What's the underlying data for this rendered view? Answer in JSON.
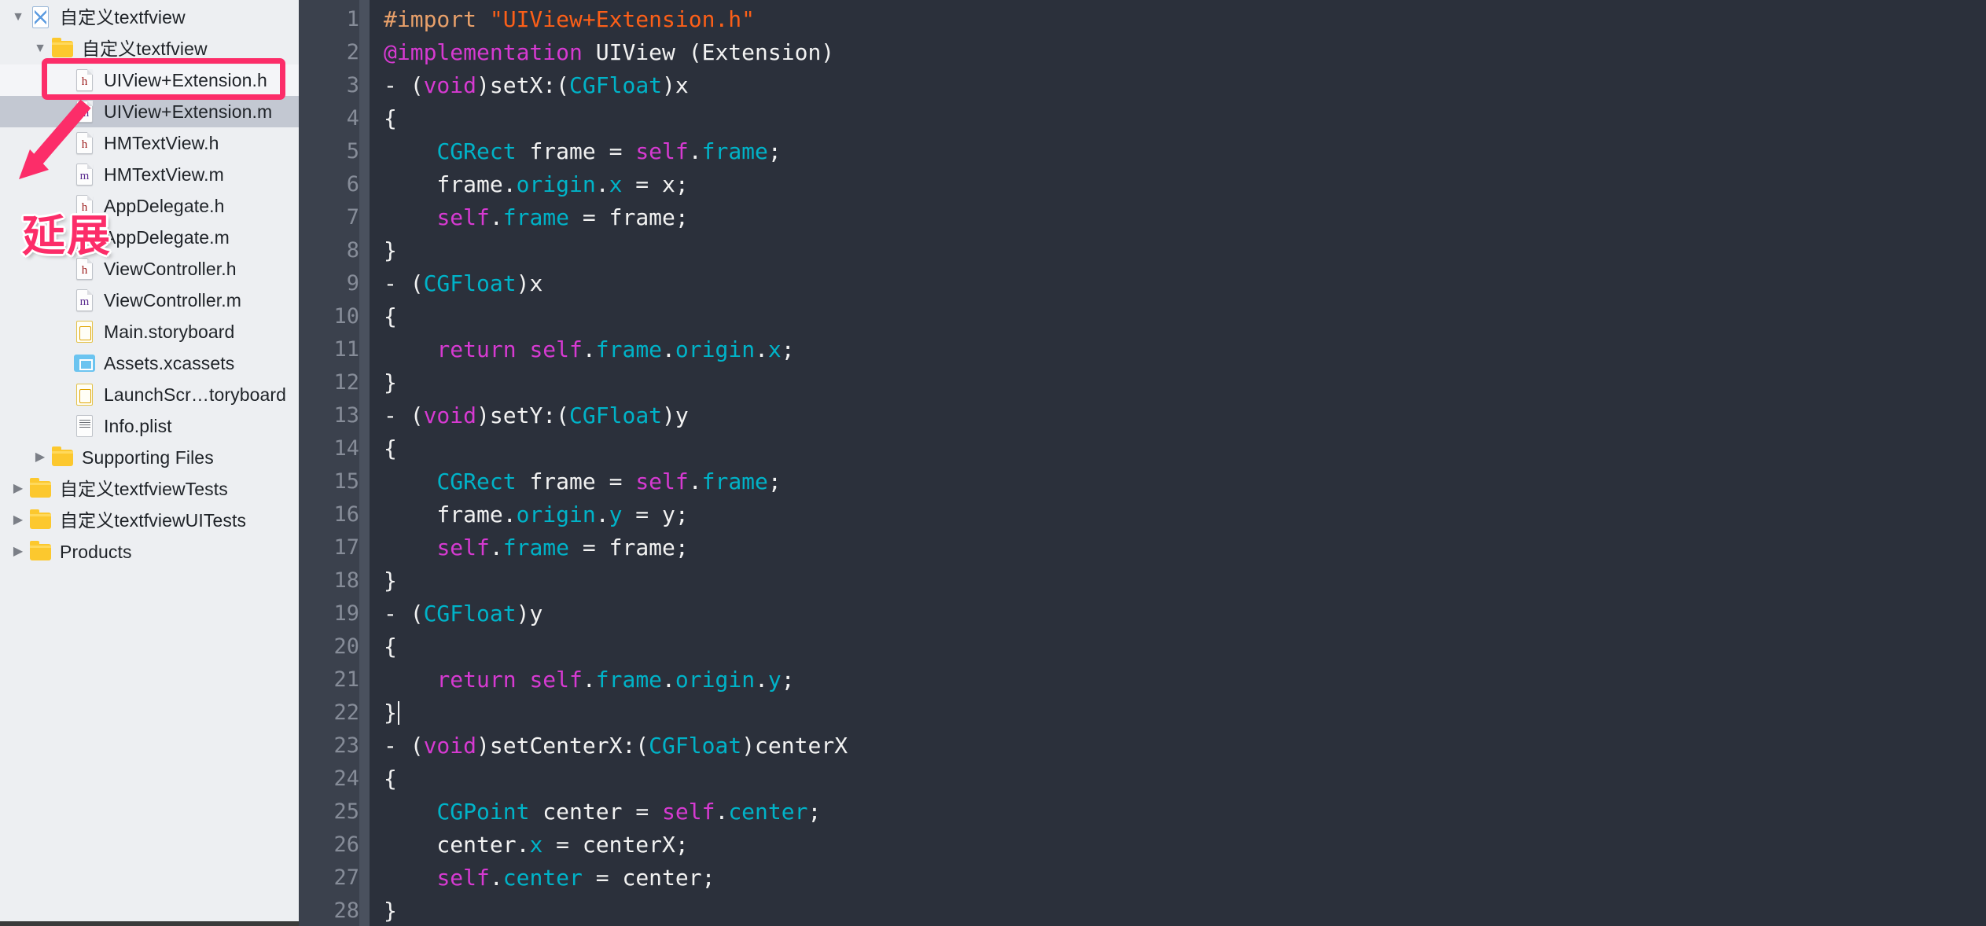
{
  "app": {
    "name": "Xcode",
    "window_title": "自定义textfview"
  },
  "colors": {
    "sidebar_bg": "#EDEFF2",
    "sidebar_selected": "#C3C8D2",
    "editor_bg": "#2B303B",
    "gutter_bg": "#3B414D",
    "annotation_pink": "#FC2D69",
    "keyword": "#D63AD1",
    "type": "#00B3C8",
    "string": "#FC5F18",
    "preprocessor": "#E8A06A",
    "plain_text": "#F2F2F2",
    "line_number": "#868C98"
  },
  "sidebar": {
    "name": "project-navigator",
    "items": [
      {
        "label": "自定义textfview",
        "indent": 0,
        "disclosure": "open",
        "icon": "xcode-project-icon",
        "state": "normal"
      },
      {
        "label": "自定义textfview",
        "indent": 1,
        "disclosure": "open",
        "icon": "folder-icon",
        "state": "normal"
      },
      {
        "label": "UIView+Extension.h",
        "indent": 2,
        "disclosure": "none",
        "icon": "header-file-icon",
        "state": "highlighted"
      },
      {
        "label": "UIView+Extension.m",
        "indent": 2,
        "disclosure": "none",
        "icon": "objc-file-icon",
        "state": "selected"
      },
      {
        "label": "HMTextView.h",
        "indent": 2,
        "disclosure": "none",
        "icon": "header-file-icon",
        "state": "normal"
      },
      {
        "label": "HMTextView.m",
        "indent": 2,
        "disclosure": "none",
        "icon": "objc-file-icon",
        "state": "normal"
      },
      {
        "label": "AppDelegate.h",
        "indent": 2,
        "disclosure": "none",
        "icon": "header-file-icon",
        "state": "normal"
      },
      {
        "label": "AppDelegate.m",
        "indent": 2,
        "disclosure": "none",
        "icon": "objc-file-icon",
        "state": "normal"
      },
      {
        "label": "ViewController.h",
        "indent": 2,
        "disclosure": "none",
        "icon": "header-file-icon",
        "state": "normal"
      },
      {
        "label": "ViewController.m",
        "indent": 2,
        "disclosure": "none",
        "icon": "objc-file-icon",
        "state": "normal"
      },
      {
        "label": "Main.storyboard",
        "indent": 2,
        "disclosure": "none",
        "icon": "storyboard-icon",
        "state": "normal"
      },
      {
        "label": "Assets.xcassets",
        "indent": 2,
        "disclosure": "none",
        "icon": "xcassets-icon",
        "state": "normal"
      },
      {
        "label": "LaunchScr…toryboard",
        "indent": 2,
        "disclosure": "none",
        "icon": "storyboard-icon",
        "state": "normal"
      },
      {
        "label": "Info.plist",
        "indent": 2,
        "disclosure": "none",
        "icon": "plist-icon",
        "state": "normal"
      },
      {
        "label": "Supporting Files",
        "indent": 1,
        "disclosure": "closed",
        "icon": "folder-icon",
        "state": "normal"
      },
      {
        "label": "自定义textfviewTests",
        "indent": 0,
        "disclosure": "closed",
        "icon": "folder-icon",
        "state": "normal"
      },
      {
        "label": "自定义textfviewUITests",
        "indent": 0,
        "disclosure": "closed",
        "icon": "folder-icon",
        "state": "normal"
      },
      {
        "label": "Products",
        "indent": 0,
        "disclosure": "closed",
        "icon": "folder-icon",
        "state": "normal"
      }
    ]
  },
  "annotation": {
    "callout_text": "延展",
    "color": "#FC2D69",
    "highlight_target": "UIView+Extension.h / UIView+Extension.m",
    "arrow": "arrow-down-left"
  },
  "editor": {
    "name": "source-code-editor",
    "language": "Objective-C",
    "cursor_line": 22,
    "first_line": 1,
    "last_line": 28,
    "lines": [
      {
        "n": 1,
        "tokens": [
          {
            "t": "#import ",
            "c": "pre"
          },
          {
            "t": "\"UIView+Extension.h\"",
            "c": "str"
          }
        ]
      },
      {
        "n": 2,
        "tokens": [
          {
            "t": "@implementation",
            "c": "kw"
          },
          {
            "t": " UIView (Extension)",
            "c": "plain"
          }
        ]
      },
      {
        "n": 3,
        "tokens": [
          {
            "t": "- (",
            "c": "plain"
          },
          {
            "t": "void",
            "c": "kw"
          },
          {
            "t": ")setX:(",
            "c": "plain"
          },
          {
            "t": "CGFloat",
            "c": "type"
          },
          {
            "t": ")x",
            "c": "plain"
          }
        ]
      },
      {
        "n": 4,
        "tokens": [
          {
            "t": "{",
            "c": "plain"
          }
        ]
      },
      {
        "n": 5,
        "tokens": [
          {
            "t": "    ",
            "c": "plain"
          },
          {
            "t": "CGRect",
            "c": "type"
          },
          {
            "t": " frame = ",
            "c": "plain"
          },
          {
            "t": "self",
            "c": "kw"
          },
          {
            "t": ".",
            "c": "plain"
          },
          {
            "t": "frame",
            "c": "type"
          },
          {
            "t": ";",
            "c": "plain"
          }
        ]
      },
      {
        "n": 6,
        "tokens": [
          {
            "t": "    frame.",
            "c": "plain"
          },
          {
            "t": "origin",
            "c": "type"
          },
          {
            "t": ".",
            "c": "plain"
          },
          {
            "t": "x",
            "c": "type"
          },
          {
            "t": " = x;",
            "c": "plain"
          }
        ]
      },
      {
        "n": 7,
        "tokens": [
          {
            "t": "    ",
            "c": "plain"
          },
          {
            "t": "self",
            "c": "kw"
          },
          {
            "t": ".",
            "c": "plain"
          },
          {
            "t": "frame",
            "c": "type"
          },
          {
            "t": " = frame;",
            "c": "plain"
          }
        ]
      },
      {
        "n": 8,
        "tokens": [
          {
            "t": "}",
            "c": "plain"
          }
        ]
      },
      {
        "n": 9,
        "tokens": [
          {
            "t": "- (",
            "c": "plain"
          },
          {
            "t": "CGFloat",
            "c": "type"
          },
          {
            "t": ")x",
            "c": "plain"
          }
        ]
      },
      {
        "n": 10,
        "tokens": [
          {
            "t": "{",
            "c": "plain"
          }
        ]
      },
      {
        "n": 11,
        "tokens": [
          {
            "t": "    ",
            "c": "plain"
          },
          {
            "t": "return",
            "c": "kw"
          },
          {
            "t": " ",
            "c": "plain"
          },
          {
            "t": "self",
            "c": "kw"
          },
          {
            "t": ".",
            "c": "plain"
          },
          {
            "t": "frame",
            "c": "type"
          },
          {
            "t": ".",
            "c": "plain"
          },
          {
            "t": "origin",
            "c": "type"
          },
          {
            "t": ".",
            "c": "plain"
          },
          {
            "t": "x",
            "c": "type"
          },
          {
            "t": ";",
            "c": "plain"
          }
        ]
      },
      {
        "n": 12,
        "tokens": [
          {
            "t": "}",
            "c": "plain"
          }
        ]
      },
      {
        "n": 13,
        "tokens": [
          {
            "t": "- (",
            "c": "plain"
          },
          {
            "t": "void",
            "c": "kw"
          },
          {
            "t": ")setY:(",
            "c": "plain"
          },
          {
            "t": "CGFloat",
            "c": "type"
          },
          {
            "t": ")y",
            "c": "plain"
          }
        ]
      },
      {
        "n": 14,
        "tokens": [
          {
            "t": "{",
            "c": "plain"
          }
        ]
      },
      {
        "n": 15,
        "tokens": [
          {
            "t": "    ",
            "c": "plain"
          },
          {
            "t": "CGRect",
            "c": "type"
          },
          {
            "t": " frame = ",
            "c": "plain"
          },
          {
            "t": "self",
            "c": "kw"
          },
          {
            "t": ".",
            "c": "plain"
          },
          {
            "t": "frame",
            "c": "type"
          },
          {
            "t": ";",
            "c": "plain"
          }
        ]
      },
      {
        "n": 16,
        "tokens": [
          {
            "t": "    frame.",
            "c": "plain"
          },
          {
            "t": "origin",
            "c": "type"
          },
          {
            "t": ".",
            "c": "plain"
          },
          {
            "t": "y",
            "c": "type"
          },
          {
            "t": " = y;",
            "c": "plain"
          }
        ]
      },
      {
        "n": 17,
        "tokens": [
          {
            "t": "    ",
            "c": "plain"
          },
          {
            "t": "self",
            "c": "kw"
          },
          {
            "t": ".",
            "c": "plain"
          },
          {
            "t": "frame",
            "c": "type"
          },
          {
            "t": " = frame;",
            "c": "plain"
          }
        ]
      },
      {
        "n": 18,
        "tokens": [
          {
            "t": "}",
            "c": "plain"
          }
        ]
      },
      {
        "n": 19,
        "tokens": [
          {
            "t": "- (",
            "c": "plain"
          },
          {
            "t": "CGFloat",
            "c": "type"
          },
          {
            "t": ")y",
            "c": "plain"
          }
        ]
      },
      {
        "n": 20,
        "tokens": [
          {
            "t": "{",
            "c": "plain"
          }
        ]
      },
      {
        "n": 21,
        "tokens": [
          {
            "t": "    ",
            "c": "plain"
          },
          {
            "t": "return",
            "c": "kw"
          },
          {
            "t": " ",
            "c": "plain"
          },
          {
            "t": "self",
            "c": "kw"
          },
          {
            "t": ".",
            "c": "plain"
          },
          {
            "t": "frame",
            "c": "type"
          },
          {
            "t": ".",
            "c": "plain"
          },
          {
            "t": "origin",
            "c": "type"
          },
          {
            "t": ".",
            "c": "plain"
          },
          {
            "t": "y",
            "c": "type"
          },
          {
            "t": ";",
            "c": "plain"
          }
        ]
      },
      {
        "n": 22,
        "tokens": [
          {
            "t": "}",
            "c": "plain"
          }
        ],
        "cursor": true
      },
      {
        "n": 23,
        "tokens": [
          {
            "t": "- (",
            "c": "plain"
          },
          {
            "t": "void",
            "c": "kw"
          },
          {
            "t": ")setCenterX:(",
            "c": "plain"
          },
          {
            "t": "CGFloat",
            "c": "type"
          },
          {
            "t": ")centerX",
            "c": "plain"
          }
        ]
      },
      {
        "n": 24,
        "tokens": [
          {
            "t": "{",
            "c": "plain"
          }
        ]
      },
      {
        "n": 25,
        "tokens": [
          {
            "t": "    ",
            "c": "plain"
          },
          {
            "t": "CGPoint",
            "c": "type"
          },
          {
            "t": " center = ",
            "c": "plain"
          },
          {
            "t": "self",
            "c": "kw"
          },
          {
            "t": ".",
            "c": "plain"
          },
          {
            "t": "center",
            "c": "type"
          },
          {
            "t": ";",
            "c": "plain"
          }
        ]
      },
      {
        "n": 26,
        "tokens": [
          {
            "t": "    center.",
            "c": "plain"
          },
          {
            "t": "x",
            "c": "type"
          },
          {
            "t": " = centerX;",
            "c": "plain"
          }
        ]
      },
      {
        "n": 27,
        "tokens": [
          {
            "t": "    ",
            "c": "plain"
          },
          {
            "t": "self",
            "c": "kw"
          },
          {
            "t": ".",
            "c": "plain"
          },
          {
            "t": "center",
            "c": "type"
          },
          {
            "t": " = center;",
            "c": "plain"
          }
        ]
      },
      {
        "n": 28,
        "tokens": [
          {
            "t": "}",
            "c": "plain"
          }
        ]
      }
    ]
  }
}
